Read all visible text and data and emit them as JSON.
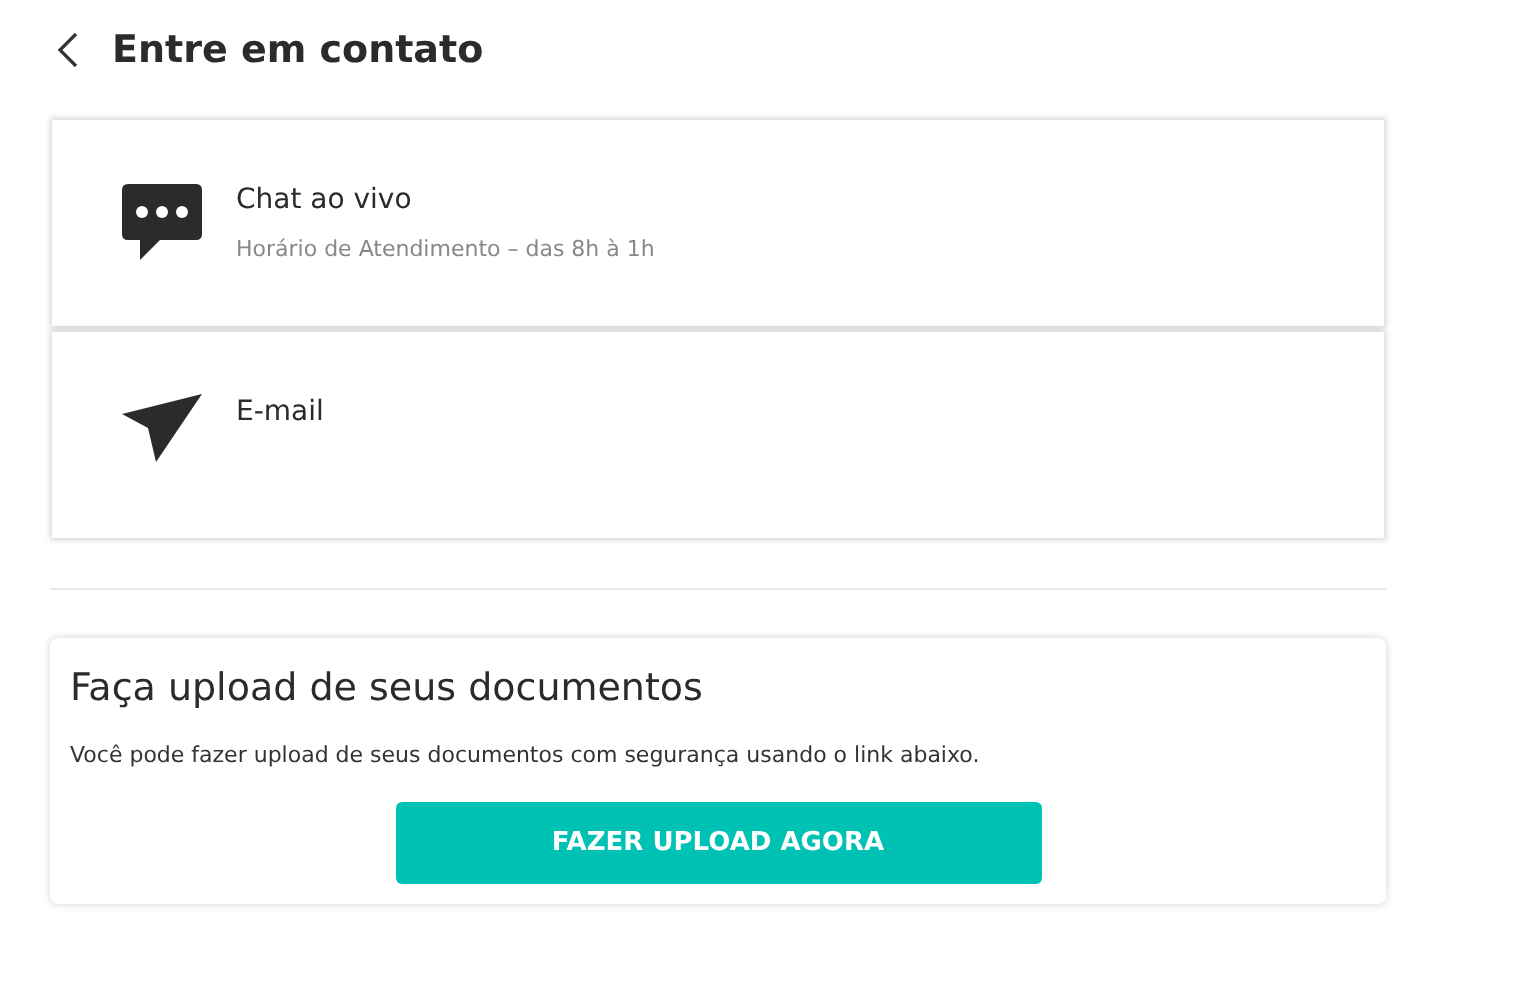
{
  "header": {
    "title": "Entre em contato"
  },
  "contact_options": [
    {
      "kind": "chat",
      "title": "Chat ao vivo",
      "subtitle": "Horário de Atendimento – das 8h à 1h"
    },
    {
      "kind": "email",
      "title": "E-mail"
    }
  ],
  "upload": {
    "title": "Faça upload de seus documentos",
    "text": "Você pode fazer upload de seus documentos com segurança usando o link abaixo.",
    "button": "FAZER UPLOAD AGORA"
  }
}
